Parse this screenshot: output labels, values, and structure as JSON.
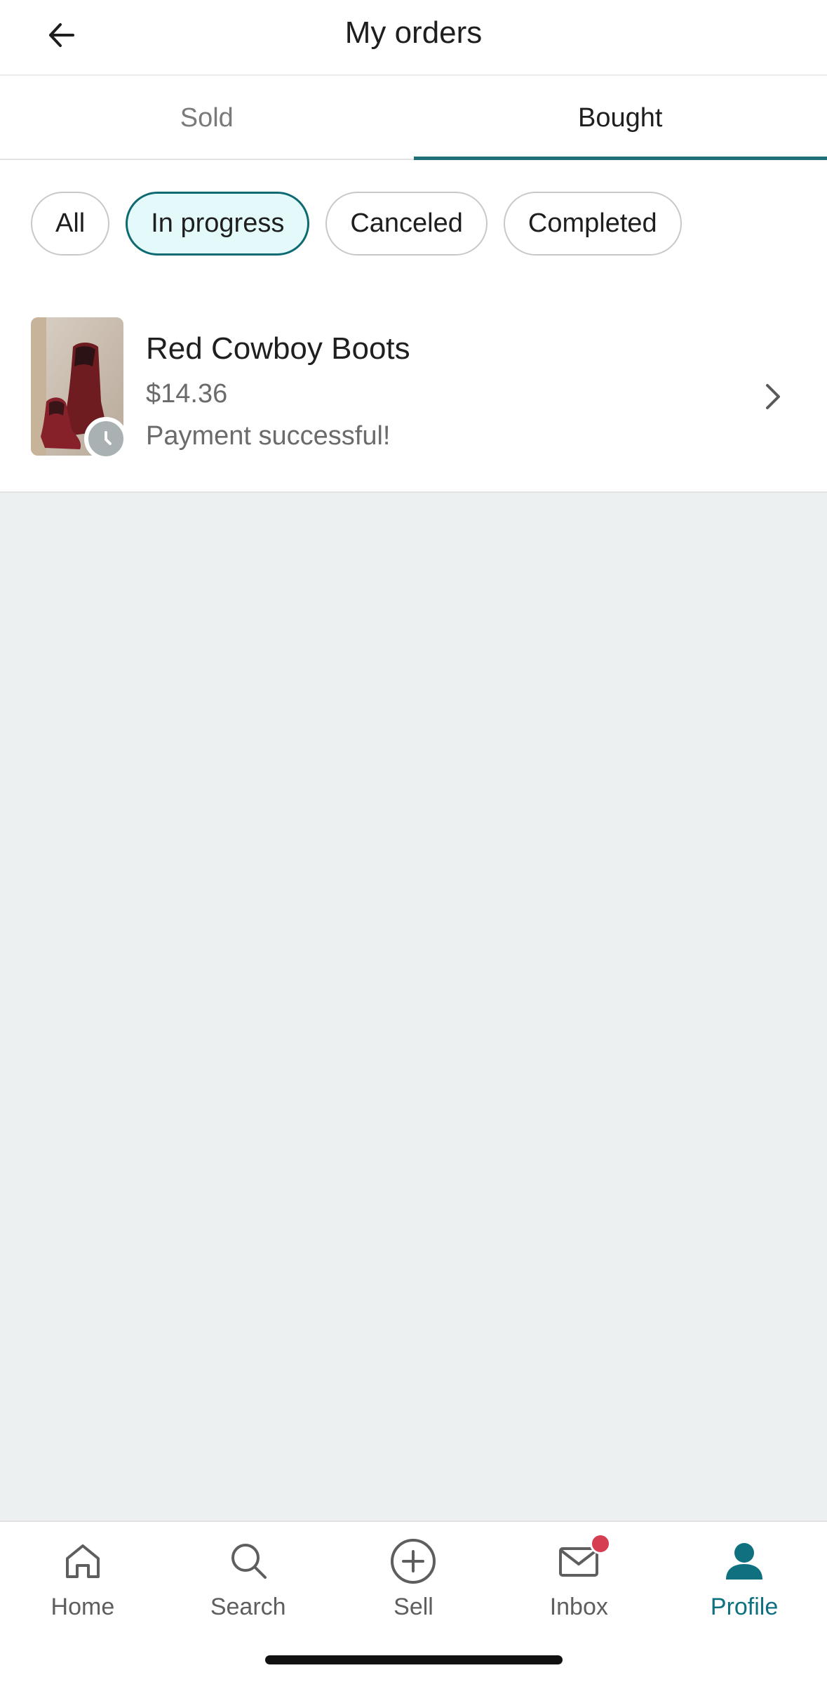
{
  "colors": {
    "accent": "#1e6f7a",
    "chip_active_bg": "#e4fafa",
    "badge": "#d63c52",
    "nav_active": "#0f7180"
  },
  "header": {
    "title": "My orders",
    "back_icon": "arrow-left-icon"
  },
  "tabs": [
    {
      "label": "Sold",
      "active": false
    },
    {
      "label": "Bought",
      "active": true
    }
  ],
  "filters": [
    {
      "label": "All",
      "active": false
    },
    {
      "label": "In progress",
      "active": true
    },
    {
      "label": "Canceled",
      "active": false
    },
    {
      "label": "Completed",
      "active": false
    }
  ],
  "orders": [
    {
      "title": "Red Cowboy Boots",
      "price": "$14.36",
      "status": "Payment successful!",
      "status_icon": "clock-icon"
    }
  ],
  "nav": [
    {
      "label": "Home",
      "icon": "home-icon",
      "active": false
    },
    {
      "label": "Search",
      "icon": "search-icon",
      "active": false
    },
    {
      "label": "Sell",
      "icon": "plus-circle-icon",
      "active": false
    },
    {
      "label": "Inbox",
      "icon": "mail-icon",
      "active": false,
      "badge": true
    },
    {
      "label": "Profile",
      "icon": "person-icon",
      "active": true
    }
  ]
}
